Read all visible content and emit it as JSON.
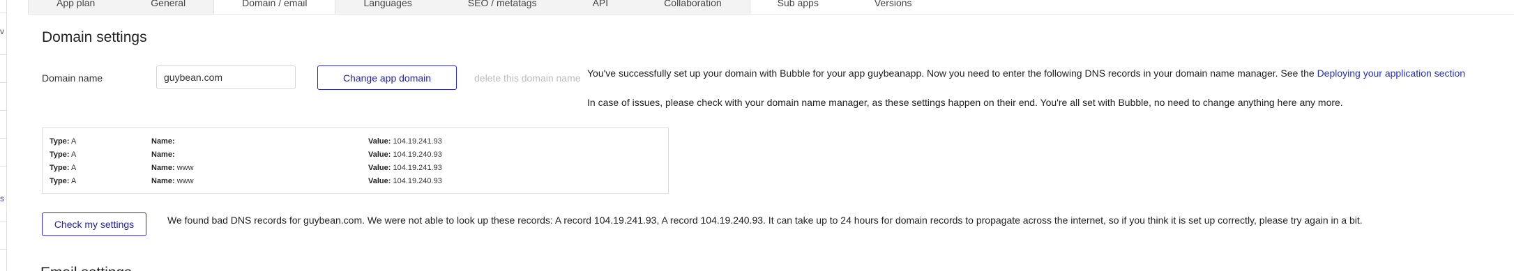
{
  "tabs": [
    {
      "label": "App plan"
    },
    {
      "label": "General"
    },
    {
      "label": "Domain / email"
    },
    {
      "label": "Languages"
    },
    {
      "label": "SEO / metatags"
    },
    {
      "label": "API"
    },
    {
      "label": "Collaboration"
    },
    {
      "label": "Sub apps"
    },
    {
      "label": "Versions"
    }
  ],
  "sidebar_fragments": {
    "top": "v",
    "bottom": "s"
  },
  "section_title": "Domain settings",
  "domain": {
    "label": "Domain name",
    "value": "guybean.com",
    "change_button": "Change app domain",
    "delete_link": "delete this domain name"
  },
  "info": {
    "line1_prefix": "You've successfully set up your domain with Bubble for your app guybeanapp. Now you need to enter the following DNS records in your domain name manager. See the ",
    "line1_link": "Deploying your application section",
    "line2": "In case of issues, please check with your domain name manager, as these settings happen on their end. You're all set with Bubble, no need to change anything here any more."
  },
  "dns_records": {
    "type_label": "Type:",
    "name_label": "Name:",
    "value_label": "Value:",
    "rows": [
      {
        "type": "A",
        "name": "",
        "value": "104.19.241.93"
      },
      {
        "type": "A",
        "name": "",
        "value": "104.19.240.93"
      },
      {
        "type": "A",
        "name": "www",
        "value": "104.19.241.93"
      },
      {
        "type": "A",
        "name": "www",
        "value": "104.19.240.93"
      }
    ]
  },
  "check": {
    "button": "Check my settings",
    "message": "We found bad DNS records for guybean.com. We were not able to look up these records: A record 104.19.241.93, A record 104.19.240.93. It can take up to 24 hours for domain records to propagate across the internet, so if you think it is set up correctly, please try again in a bit."
  },
  "next_section_title": "Email settings",
  "colors": {
    "accent": "#2222a8",
    "link": "#2230c8",
    "muted": "#bdbdbd"
  }
}
